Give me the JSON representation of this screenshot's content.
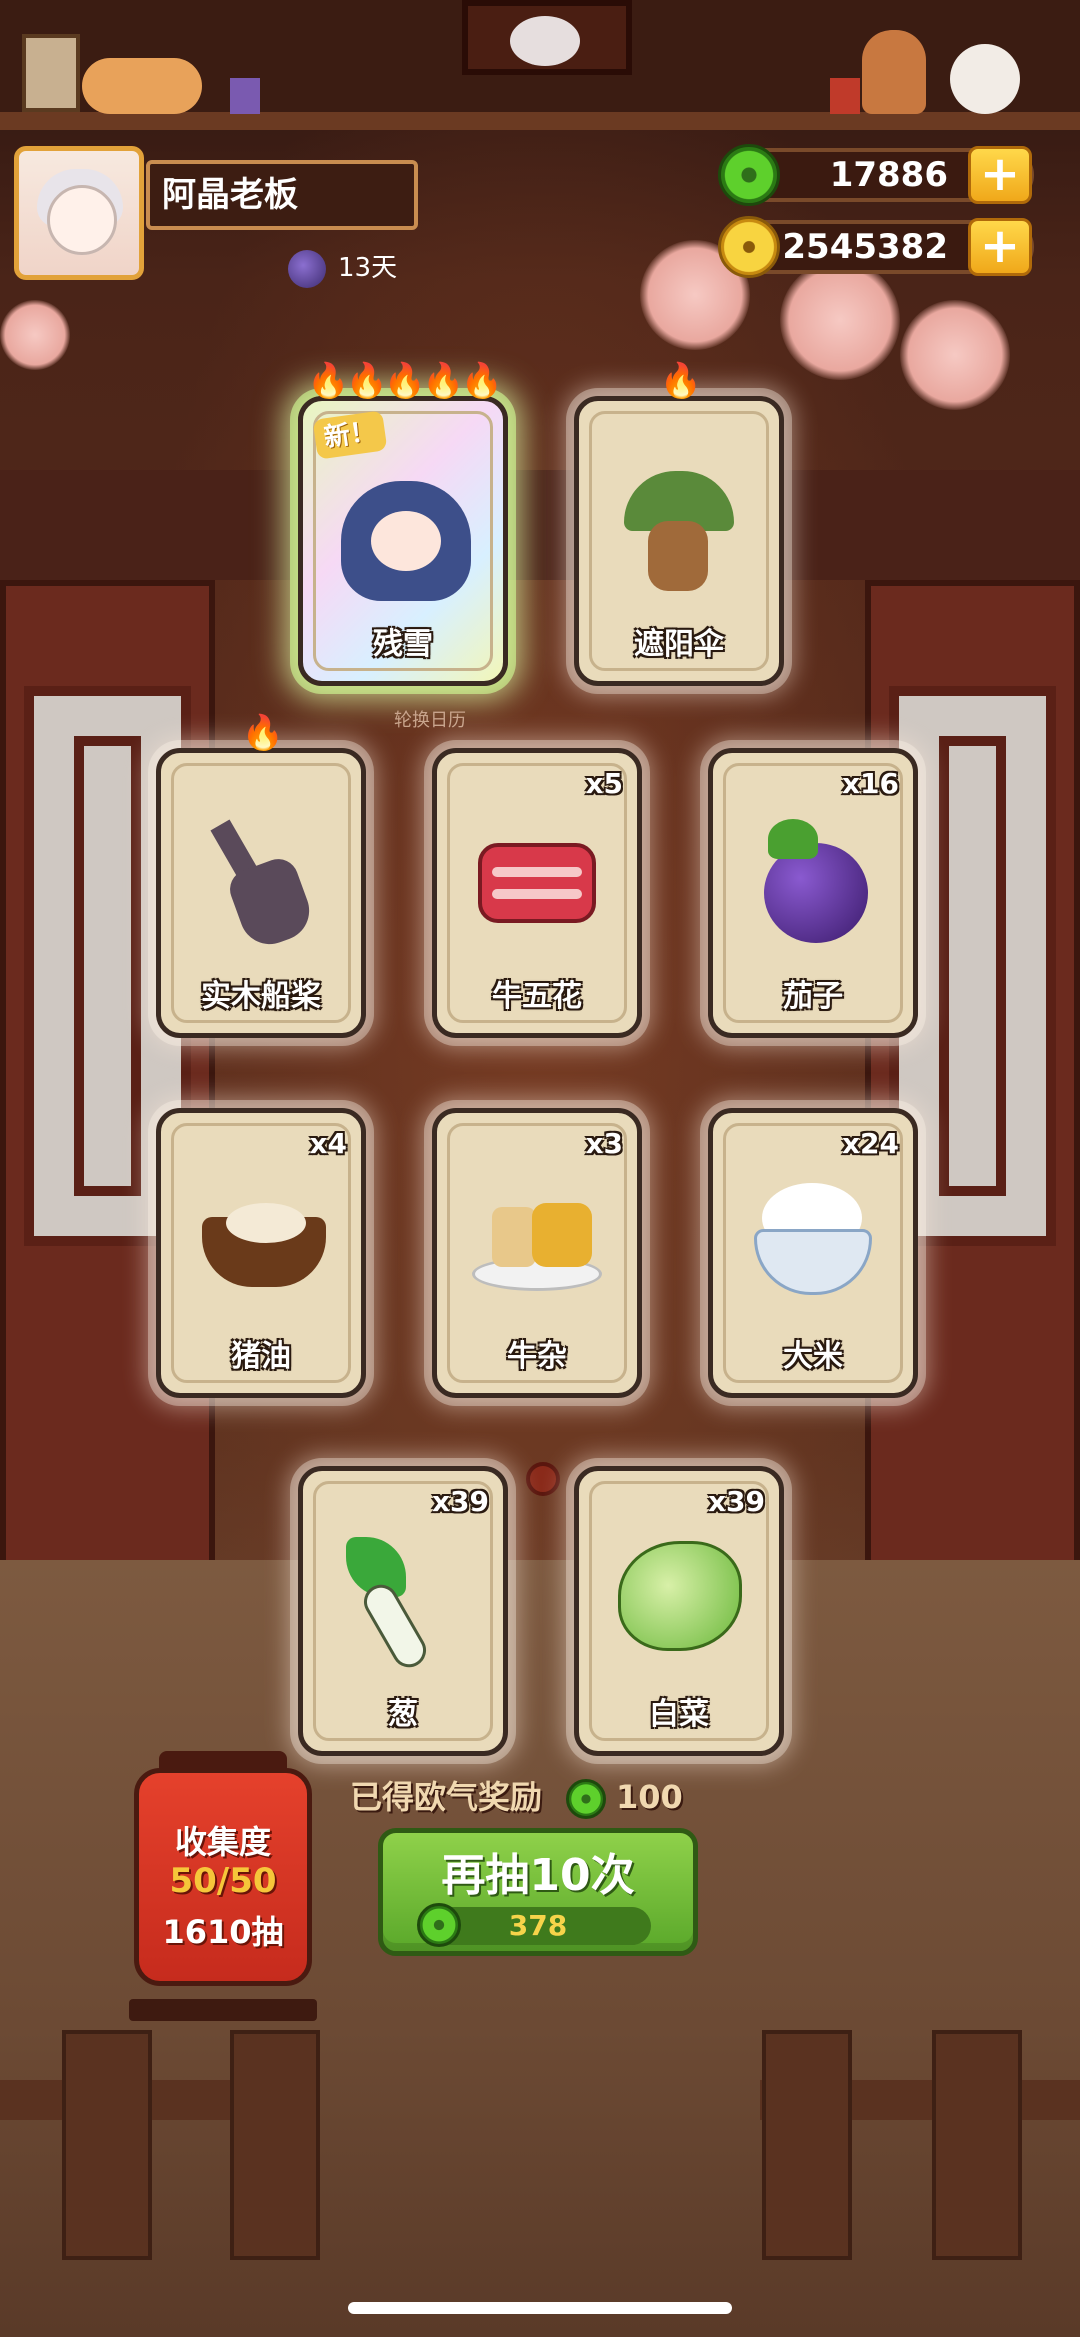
{
  "player": {
    "name": "阿晶老板",
    "days": "13天"
  },
  "currency": {
    "jade": "17886",
    "coins": "2545382",
    "plus": "+"
  },
  "featured": [
    {
      "name": "残雪",
      "new_tag": "新！",
      "flames": "🔥🔥🔥🔥🔥"
    },
    {
      "name": "遮阳伞",
      "flames": "🔥"
    }
  ],
  "featured_caption": "轮换日历",
  "cards": [
    {
      "name": "实木船桨",
      "count": "",
      "flames": "🔥"
    },
    {
      "name": "牛五花",
      "count": "x5"
    },
    {
      "name": "茄子",
      "count": "x16"
    },
    {
      "name": "猪油",
      "count": "x4"
    },
    {
      "name": "牛杂",
      "count": "x3"
    },
    {
      "name": "大米",
      "count": "x24"
    },
    {
      "name": "葱",
      "count": "x39"
    },
    {
      "name": "白菜",
      "count": "x39"
    }
  ],
  "collection": {
    "title": "收集度",
    "progress": "50/50",
    "draws": "1610抽"
  },
  "reward": {
    "label": "已得欧气奖励",
    "amount": "100"
  },
  "draw_button": {
    "label": "再抽10次",
    "cost": "378"
  },
  "colors": {
    "accent_green": "#5aa82a",
    "gold": "#f0a81a",
    "lantern_red": "#c62b1d"
  }
}
